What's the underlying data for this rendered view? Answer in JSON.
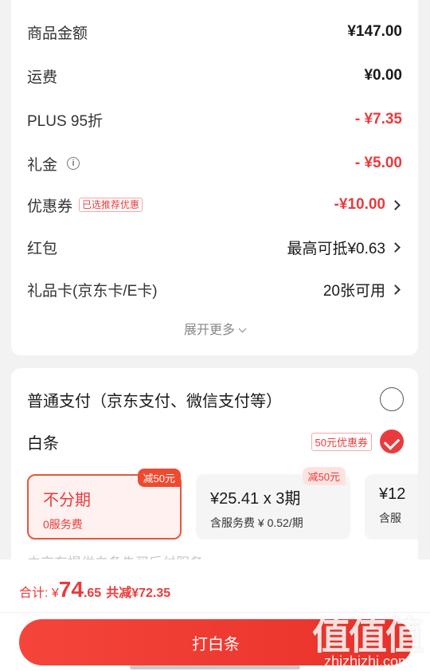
{
  "summary": {
    "goods_label": "商品金额",
    "goods_value": "¥147.00",
    "shipping_label": "运费",
    "shipping_value": "¥0.00",
    "plus_label": "PLUS 95折",
    "plus_value": "- ¥7.35",
    "gift_label": "礼金",
    "gift_info_icon": "i",
    "gift_value": "- ¥5.00",
    "coupon_label": "优惠券",
    "coupon_tag": "已选推荐优惠",
    "coupon_value": "-¥10.00",
    "redpacket_label": "红包",
    "redpacket_value": "最高可抵¥0.63",
    "giftcard_label": "礼品卡(京东卡/E卡)",
    "giftcard_value": "20张可用",
    "more_label": "展开更多"
  },
  "payment": {
    "normal_label": "普通支付（京东支付、微信支付等）",
    "baitiao_label": "白条",
    "baitiao_coupon": "50元优惠券",
    "plans": [
      {
        "title": "不分期",
        "sub": "0服务费",
        "badge": "减50元"
      },
      {
        "title": "¥25.41 x 3期",
        "sub": "含服务费 ¥ 0.52/期",
        "badge": "减50元"
      },
      {
        "title": "¥12",
        "sub": "含服"
      }
    ],
    "faded_note": "由京东提供白条先买后付服务"
  },
  "footer": {
    "total_prefix": "合计: ¥",
    "total_int": "74",
    "total_dec": ".65",
    "saved": "共减¥72.35",
    "pay_button": "打白条"
  },
  "watermark": {
    "logo": "值值值",
    "site": "zhizhizhi.com"
  },
  "colors": {
    "accent": "#e93b3d",
    "button": "#f0392f"
  }
}
